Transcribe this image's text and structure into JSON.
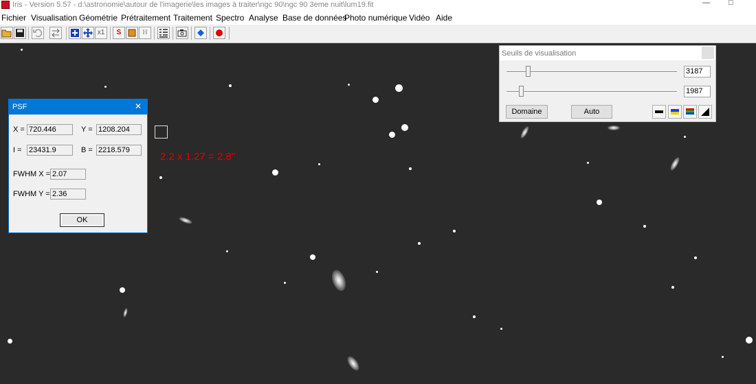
{
  "window": {
    "title": "Iris - Version 5.57 - d:\\astronomie\\autour de l'imagerie\\les images à traiter\\ngc 90\\ngc 90 3eme nuit\\lum19.fit",
    "minimize": "—",
    "maximize": "□"
  },
  "menu": [
    "Fichier",
    "Visualisation",
    "Géométrie",
    "Prétraitement",
    "Traitement",
    "Spectro",
    "Analyse",
    "Base de données",
    "Photo numérique",
    "Vidéo",
    "Aide"
  ],
  "toolbar": {
    "icons": [
      "open-icon",
      "save-icon",
      "undo-icon",
      "swap-icon",
      "zoom-in-icon",
      "move-icon",
      "x1-icon",
      "s-icon",
      "square-icon",
      "h-icon",
      "list-icon",
      "camera-icon",
      "diamond-icon",
      "record-icon"
    ],
    "x1_label": "x1",
    "h_label": "H",
    "s_label": "S"
  },
  "annotation": "2.2 x 1.27 = 2.8''",
  "psf": {
    "title": "PSF",
    "close": "✕",
    "x_label": "X =",
    "x_value": "720.446",
    "y_label": "Y =",
    "y_value": "1208.204",
    "i_label": "I =",
    "i_value": "23431.9",
    "b_label": "B =",
    "b_value": "2218.579",
    "fwhm_x_label": "FWHM X =",
    "fwhm_x_value": "2.07",
    "fwhm_y_label": "FWHM Y =",
    "fwhm_y_value": "2.36",
    "ok_label": "OK"
  },
  "seuils": {
    "title": "Seuils de visualisation",
    "high_value": "3187",
    "low_value": "1987",
    "domaine_label": "Domaine",
    "auto_label": "Auto",
    "palette_icons": [
      "grayscale-icon",
      "blue-yellow-icon",
      "rainbow-icon",
      "gradient-icon"
    ]
  }
}
